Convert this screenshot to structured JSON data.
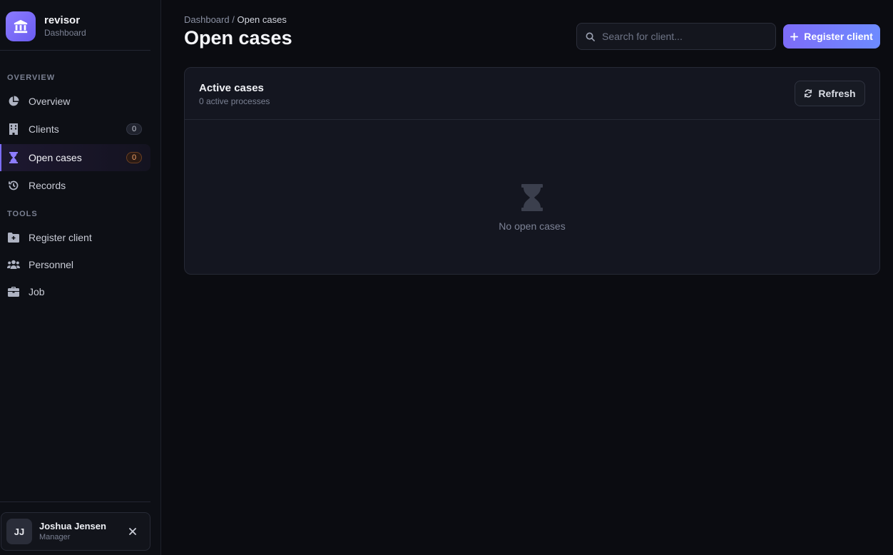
{
  "brand": {
    "name": "revisor",
    "subtitle": "Dashboard",
    "icon": "bank-icon",
    "accent": "#7b6cf6"
  },
  "sidebar": {
    "sections": [
      {
        "label": "OVERVIEW",
        "items": [
          {
            "label": "Overview",
            "icon": "pie-chart-icon",
            "active": false
          },
          {
            "label": "Clients",
            "icon": "building-icon",
            "badge": "0",
            "active": false
          },
          {
            "label": "Open cases",
            "icon": "hourglass-icon",
            "badge": "0",
            "active": true
          },
          {
            "label": "Records",
            "icon": "history-icon",
            "active": false
          }
        ]
      },
      {
        "label": "TOOLS",
        "items": [
          {
            "label": "Register client",
            "icon": "folder-plus-icon"
          },
          {
            "label": "Personnel",
            "icon": "users-icon"
          },
          {
            "label": "Job",
            "icon": "briefcase-icon"
          }
        ]
      }
    ]
  },
  "user": {
    "initials": "JJ",
    "name": "Joshua Jensen",
    "role": "Manager"
  },
  "header": {
    "breadcrumb": {
      "parent": "Dashboard",
      "separator": "/",
      "current": "Open cases"
    },
    "title": "Open cases",
    "search": {
      "placeholder": "Search for client...",
      "value": ""
    },
    "primary_button": "Register client"
  },
  "card": {
    "title": "Active cases",
    "subtitle": "0 active processes",
    "refresh_label": "Refresh",
    "empty_text": "No open cases"
  }
}
